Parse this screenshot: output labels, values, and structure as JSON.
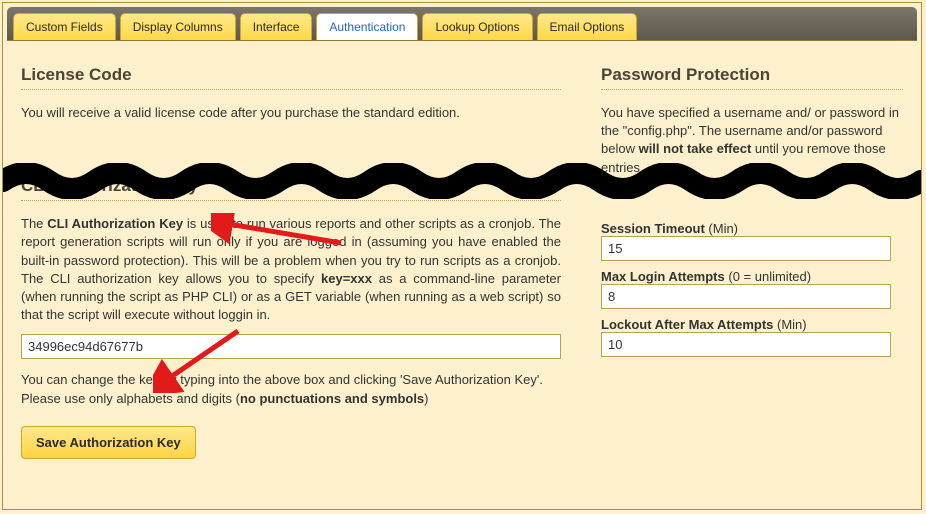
{
  "tabs": [
    {
      "label": "Custom Fields"
    },
    {
      "label": "Display Columns"
    },
    {
      "label": "Interface"
    },
    {
      "label": "Authentication"
    },
    {
      "label": "Lookup Options"
    },
    {
      "label": "Email Options"
    }
  ],
  "left": {
    "license_heading": "License Code",
    "license_text": "You will receive a valid license code after you purchase the standard edition.",
    "cli_heading": "CLI Authorization Key",
    "cli_para_pre": "The ",
    "cli_para_bold1": "CLI Authorization Key",
    "cli_para_mid": " is used to run various reports and other scripts as a cronjob. The report generation scripts will run only if you are logged in (assuming you have enabled the built-in password protection). This will be a problem when you try to run scripts as a cronjob. The CLI authorization key allows you to specify ",
    "cli_para_bold2": "key=xxx",
    "cli_para_post": " as a command-line parameter (when running the script as PHP CLI) or as a GET variable (when running as a web script) so that the script will execute without loggin in.",
    "cli_key_value": "34996ec94d67677b",
    "cli_change_pre": "You can change the key by typing into the above box and clicking 'Save Authorization Key'. Please use only alphabets and digits (",
    "cli_change_bold": "no punctuations and symbols",
    "cli_change_post": ")",
    "save_btn": "Save Authorization Key"
  },
  "right": {
    "pw_heading": "Password Protection",
    "pw_para_pre": "You have specified a username and/ or password in the \"config.php\". The username and/or password below ",
    "pw_para_bold": "will not take effect",
    "pw_para_post": " until you remove those entries.",
    "session_label": "Session Timeout",
    "session_hint": " (Min)",
    "session_value": "15",
    "maxlogin_label": "Max Login Attempts",
    "maxlogin_hint": " (0 = unlimited)",
    "maxlogin_value": "8",
    "lockout_label": "Lockout After Max Attempts",
    "lockout_hint": " (Min)",
    "lockout_value": "10"
  }
}
